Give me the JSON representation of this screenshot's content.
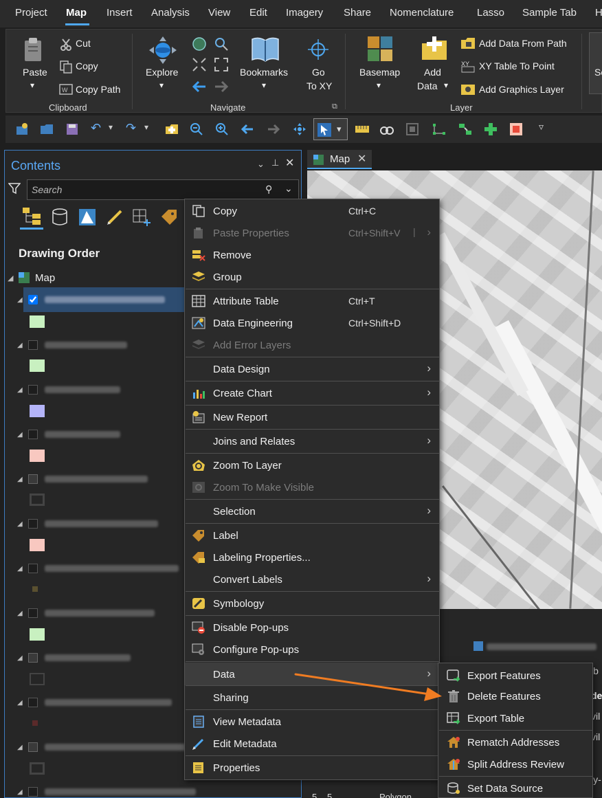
{
  "tabs": [
    "Project",
    "Map",
    "Insert",
    "Analysis",
    "View",
    "Edit",
    "Imagery",
    "Share",
    "Nomenclature",
    "Lasso",
    "Sample Tab",
    "H"
  ],
  "ribbon": {
    "clipboard": {
      "paste": "Paste",
      "cut": "Cut",
      "copy": "Copy",
      "copy_path": "Copy Path",
      "label": "Clipboard"
    },
    "navigate": {
      "explore": "Explore",
      "bookmarks": "Bookmarks",
      "go_to": "Go",
      "go_to_2": "To XY",
      "label": "Navigate"
    },
    "layer": {
      "basemap": "Basemap",
      "add_data": "Add",
      "add_data_2": "Data",
      "add_from_path": "Add Data From Path",
      "xy_table": "XY Table To Point",
      "add_graphics": "Add Graphics Layer",
      "label": "Layer"
    },
    "partial": "Se"
  },
  "contents": {
    "title": "Contents",
    "search_placeholder": "Search",
    "drawing_order": "Drawing Order",
    "map_label": "Map"
  },
  "map_tab": {
    "label": "Map"
  },
  "context_menu": {
    "items": [
      {
        "label": "Copy",
        "shortcut": "Ctrl+C"
      },
      {
        "label": "Paste Properties",
        "shortcut": "Ctrl+Shift+V"
      },
      {
        "label": "Remove"
      },
      {
        "label": "Group"
      },
      {
        "label": "Attribute Table",
        "shortcut": "Ctrl+T"
      },
      {
        "label": "Data Engineering",
        "shortcut": "Ctrl+Shift+D"
      },
      {
        "label": "Add Error Layers"
      },
      {
        "label": "Data Design"
      },
      {
        "label": "Create Chart"
      },
      {
        "label": "New Report"
      },
      {
        "label": "Joins and Relates"
      },
      {
        "label": "Zoom To Layer"
      },
      {
        "label": "Zoom To Make Visible"
      },
      {
        "label": "Selection"
      },
      {
        "label": "Label"
      },
      {
        "label": "Labeling Properties..."
      },
      {
        "label": "Convert Labels"
      },
      {
        "label": "Symbology"
      },
      {
        "label": "Disable Pop-ups"
      },
      {
        "label": "Configure Pop-ups"
      },
      {
        "label": "Data"
      },
      {
        "label": "Sharing"
      },
      {
        "label": "View Metadata"
      },
      {
        "label": "Edit Metadata"
      },
      {
        "label": "Properties"
      }
    ]
  },
  "data_submenu": {
    "items": [
      {
        "label": "Export Features"
      },
      {
        "label": "Delete Features"
      },
      {
        "label": "Export Table"
      },
      {
        "label": "Rematch Addresses"
      },
      {
        "label": "Split Address Review"
      },
      {
        "label": "Set Data Source"
      }
    ]
  },
  "attr_fragments": {
    "row_num": "5",
    "row_val": "5",
    "row_type": "Polygon",
    "col_frag_1": "ib",
    "col_frag_2": "de",
    "col_frag_3": "vil",
    "col_frag_4": "vil",
    "col_frag_5": "ly-"
  },
  "colors": {
    "accent": "#4fa8f0",
    "arrow": "#f07c22",
    "menu_bg": "#2b2b2b"
  }
}
